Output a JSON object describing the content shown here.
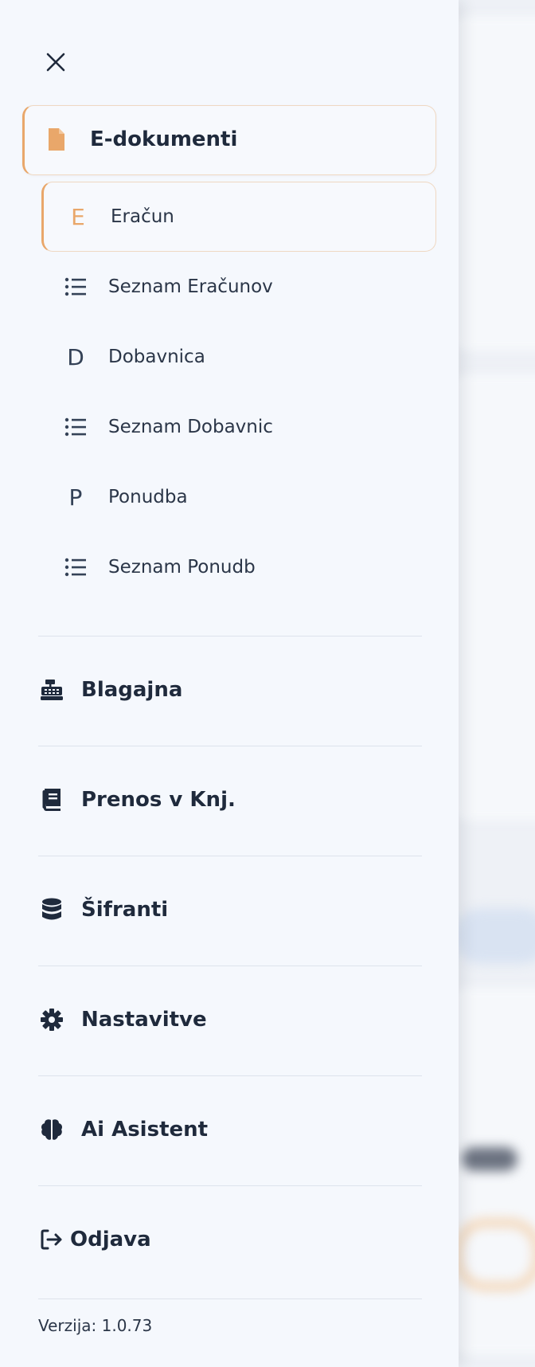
{
  "menu": {
    "close_icon": "close-icon",
    "edocs": {
      "label": "E-dokumenti",
      "icon": "file-icon"
    },
    "sub_items": [
      {
        "label": "Račun",
        "icon": "E",
        "prefix": "Ra",
        "caron": "č",
        "suffix": "un",
        "display": "Eračun"
      },
      {
        "label": "Seznam Eračunov",
        "icon": "list-icon"
      },
      {
        "label": "Dobavnica",
        "icon": "D"
      },
      {
        "label": "Seznam Dobavnic",
        "icon": "list-icon"
      },
      {
        "label": "Ponudba",
        "icon": "P"
      },
      {
        "label": "Seznam Ponudb",
        "icon": "list-icon"
      }
    ],
    "items": [
      {
        "label": "Blagajna",
        "icon": "cash-register-icon"
      },
      {
        "label": "Prenos v Knj.",
        "icon": "book-icon"
      },
      {
        "label": "Šifranti",
        "icon": "database-icon"
      },
      {
        "label": "Nastavitve",
        "icon": "gear-icon"
      },
      {
        "label": "Ai Asistent",
        "icon": "brain-icon"
      }
    ],
    "logout": {
      "label": "Odjava",
      "icon": "logout-icon"
    }
  },
  "footer": {
    "version": "Verzija: 1.0.73"
  },
  "colors": {
    "accent": "#e9a76a",
    "text": "#1f2a3c",
    "drawer_bg": "#f5f8fd"
  }
}
